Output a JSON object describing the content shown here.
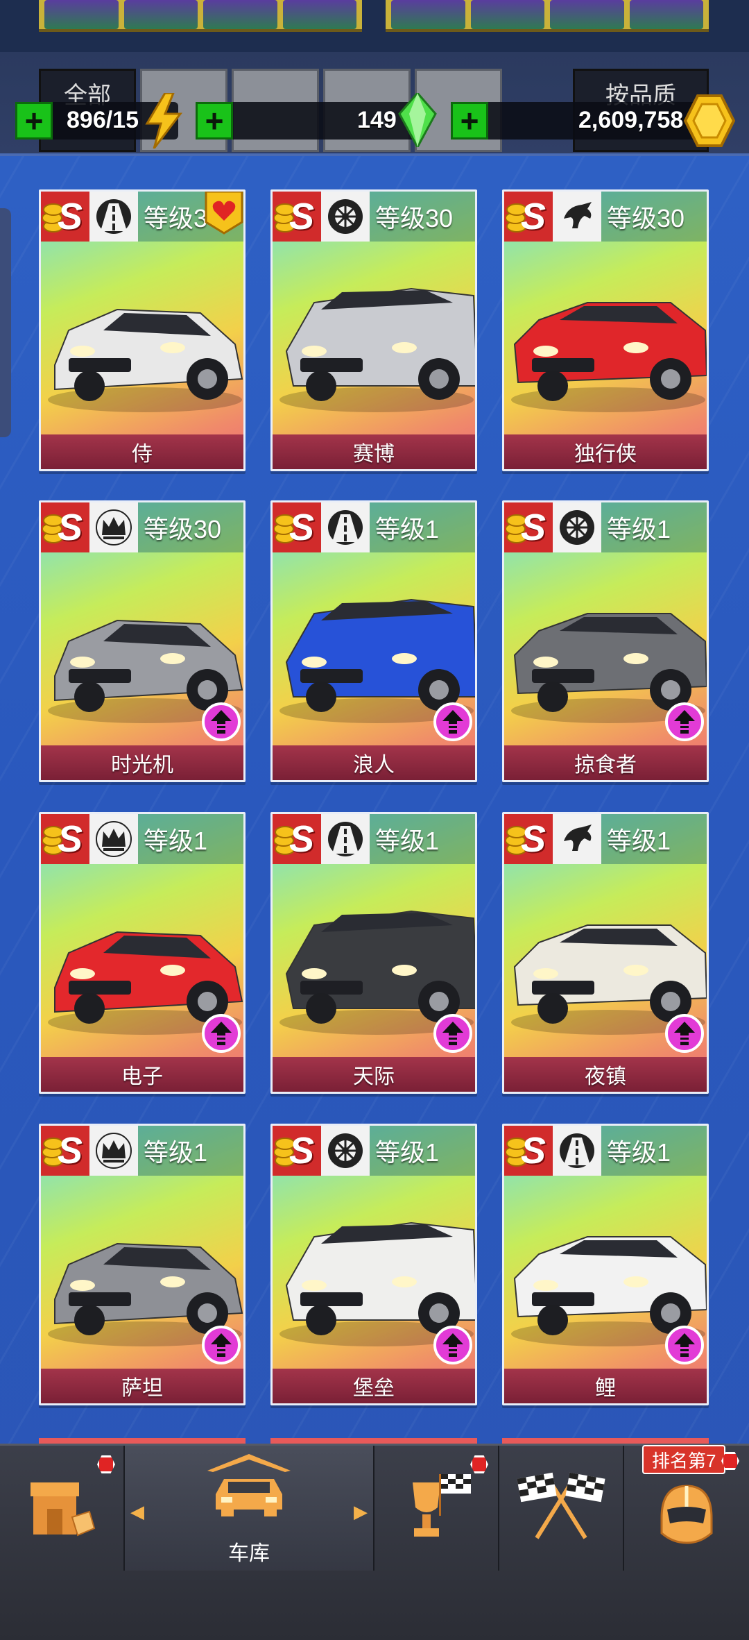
{
  "currencies": {
    "energy": {
      "value": "896/15",
      "icon": "lightning-icon"
    },
    "gems": {
      "value": "149",
      "icon": "green-gem-icon"
    },
    "coins": {
      "value": "2,609,758",
      "icon": "gold-coin-icon"
    }
  },
  "header": {
    "first_tab_label": "全部",
    "right_tab_label": "按品质"
  },
  "cards": [
    {
      "name": "侍",
      "level": "等级3",
      "type_icon": "road-icon",
      "rank": "S",
      "favorite": true,
      "upgrade": false,
      "car_color": "#e8e8e8"
    },
    {
      "name": "赛博",
      "level": "等级30",
      "type_icon": "tire-icon",
      "rank": "S",
      "favorite": false,
      "upgrade": false,
      "car_color": "#c9cbd0"
    },
    {
      "name": "独行侠",
      "level": "等级30",
      "type_icon": "horse-icon",
      "rank": "S",
      "favorite": false,
      "upgrade": false,
      "car_color": "#e0262a"
    },
    {
      "name": "时光机",
      "level": "等级30",
      "type_icon": "crown-icon",
      "rank": "S",
      "favorite": false,
      "upgrade": true,
      "car_color": "#9a9ca2"
    },
    {
      "name": "浪人",
      "level": "等级1",
      "type_icon": "road-icon",
      "rank": "S",
      "favorite": false,
      "upgrade": true,
      "car_color": "#2752d8"
    },
    {
      "name": "掠食者",
      "level": "等级1",
      "type_icon": "tire-icon",
      "rank": "S",
      "favorite": false,
      "upgrade": true,
      "car_color": "#6d6f74"
    },
    {
      "name": "电子",
      "level": "等级1",
      "type_icon": "crown-icon",
      "rank": "S",
      "favorite": false,
      "upgrade": true,
      "car_color": "#e3282c"
    },
    {
      "name": "天际",
      "level": "等级1",
      "type_icon": "road-icon",
      "rank": "S",
      "favorite": false,
      "upgrade": true,
      "car_color": "#3a3c40"
    },
    {
      "name": "夜镇",
      "level": "等级1",
      "type_icon": "horse-icon",
      "rank": "S",
      "favorite": false,
      "upgrade": true,
      "car_color": "#ece9df"
    },
    {
      "name": "萨坦",
      "level": "等级1",
      "type_icon": "crown-icon",
      "rank": "S",
      "favorite": false,
      "upgrade": true,
      "car_color": "#8e9096"
    },
    {
      "name": "堡垒",
      "level": "等级1",
      "type_icon": "tire-icon",
      "rank": "S",
      "favorite": false,
      "upgrade": true,
      "car_color": "#efefed"
    },
    {
      "name": "鲤",
      "level": "等级1",
      "type_icon": "road-icon",
      "rank": "S",
      "favorite": false,
      "upgrade": true,
      "car_color": "#f2f2f2"
    }
  ],
  "bottom_nav": {
    "shop": {
      "icon": "shop-icon",
      "has_alert": true
    },
    "garage": {
      "icon": "garage-car-icon",
      "label": "车库",
      "active": true
    },
    "trophy": {
      "icon": "trophy-icon",
      "has_alert": true
    },
    "race": {
      "icon": "checkered-flags-icon"
    },
    "profile": {
      "icon": "helmet-icon",
      "rank_label": "排名第7",
      "has_alert": true
    }
  },
  "colors": {
    "background": "#2a57b8",
    "plus_button": "#19c219",
    "card_name_bar": "#8a2840",
    "upgrade": "#e23bd6",
    "rank_badge": "#d12b2b"
  }
}
